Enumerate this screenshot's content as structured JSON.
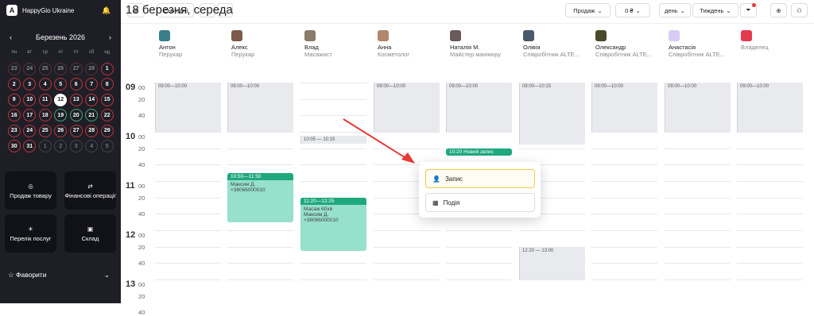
{
  "brand": "HappyGio Ukraine",
  "calendar": {
    "month": "Березень 2026",
    "weekdays": [
      "пн",
      "вт",
      "ср",
      "чт",
      "пт",
      "сб",
      "нд"
    ],
    "days": [
      "23",
      "24",
      "25",
      "26",
      "27",
      "28",
      "1",
      "2",
      "3",
      "4",
      "5",
      "6",
      "7",
      "8",
      "9",
      "10",
      "11",
      "12",
      "13",
      "14",
      "15",
      "16",
      "17",
      "18",
      "19",
      "20",
      "21",
      "22",
      "23",
      "24",
      "25",
      "26",
      "27",
      "28",
      "29",
      "30",
      "31",
      "1",
      "2",
      "3",
      "4",
      "5"
    ]
  },
  "tiles": [
    {
      "label": "Продаж товару"
    },
    {
      "label": "Фінансові операції"
    },
    {
      "label": "Перелік послуг"
    },
    {
      "label": "Склад"
    }
  ],
  "favorites": "Фаворити",
  "toolbar": {
    "today": "Сьогодні",
    "date": "18 березня, середа",
    "sale": "Продаж",
    "amount": "0 ₴",
    "day": "день",
    "week": "Тиждень"
  },
  "staff": [
    {
      "name": "Антон",
      "role": "Перукар"
    },
    {
      "name": "Алекс",
      "role": "Перукар"
    },
    {
      "name": "Влад",
      "role": "Масажист"
    },
    {
      "name": "Анна",
      "role": "Косметолог"
    },
    {
      "name": "Наталія М.",
      "role": "Майстер манікюру"
    },
    {
      "name": "Олівія",
      "role": "Співробітник ALTE..."
    },
    {
      "name": "Олександр",
      "role": "Співробітник ALTE..."
    },
    {
      "name": "Анастасія",
      "role": "Співробітник ALTE..."
    },
    {
      "name": "",
      "role": "Владелец"
    }
  ],
  "hours": [
    "09",
    "10",
    "11",
    "12",
    "13"
  ],
  "minutes": [
    "00",
    "20",
    "40"
  ],
  "slots": [
    "09:00—10:00",
    "09:00—10:00",
    "09:00—10:00",
    "09:00—10:00",
    "09:00—10:15",
    "09:00—10:00",
    "09:00—10:00",
    "09:00—10:00",
    "10:05 — 10:15",
    "12:20 — 13:00"
  ],
  "appts": [
    {
      "time": "10:50—11:50",
      "client": "Максим Д.",
      "phone": "+38066000010"
    },
    {
      "time": "11:20—12:25",
      "service": "Масаж 60хв",
      "client": "Максим Д.",
      "phone": "+38066000010"
    },
    {
      "time": "10:20 Новий запис"
    }
  ],
  "popup": {
    "record": "Запис",
    "event": "Подія"
  }
}
